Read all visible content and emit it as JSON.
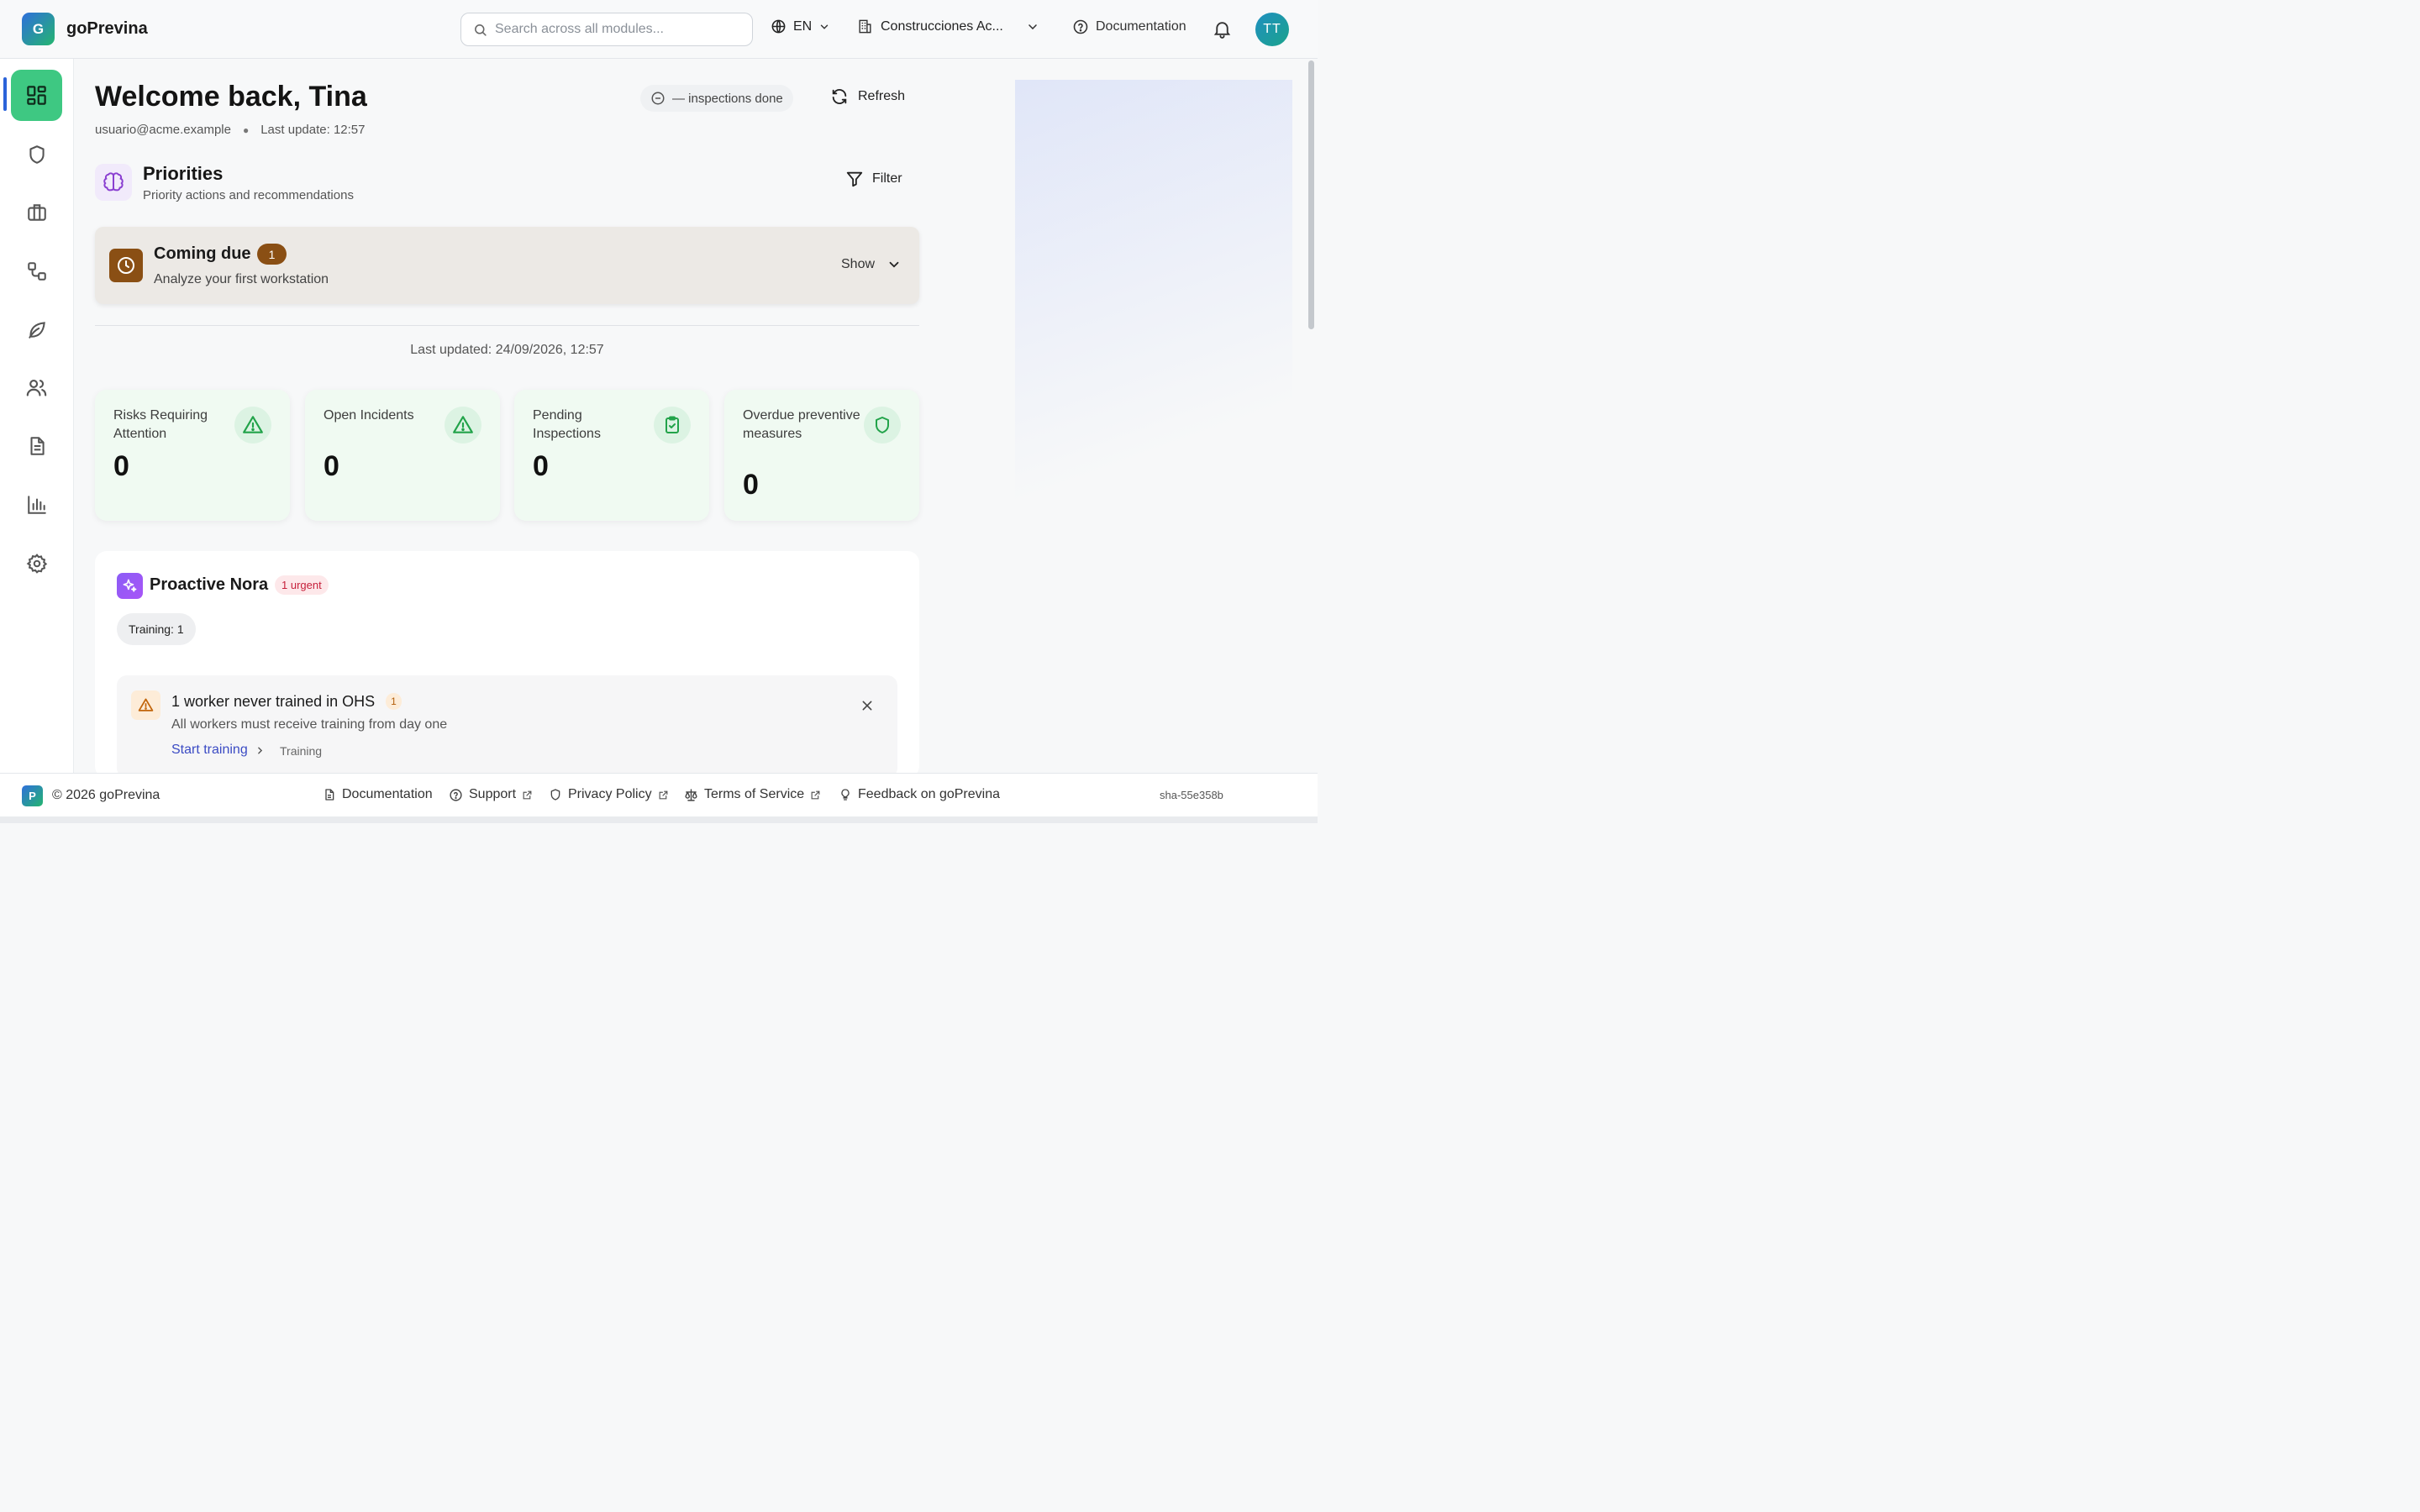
{
  "app": {
    "name": "goPrevina",
    "logo_letter": "G"
  },
  "header": {
    "search_placeholder": "Search across all modules...",
    "language": "EN",
    "company": "Construcciones Ac...",
    "docs_label": "Documentation",
    "avatar_initials": "TT"
  },
  "sidebar": {
    "items": [
      {
        "icon": "dashboard-icon",
        "active": true
      },
      {
        "icon": "shield-icon"
      },
      {
        "icon": "briefcase-icon"
      },
      {
        "icon": "workflow-icon"
      },
      {
        "icon": "leaf-icon"
      },
      {
        "icon": "users-icon"
      },
      {
        "icon": "document-icon"
      },
      {
        "icon": "bar-chart-icon"
      },
      {
        "icon": "gear-icon"
      }
    ]
  },
  "dashboard": {
    "welcome": "Welcome back, Tina",
    "email": "usuario@acme.example",
    "last_update": "Last update: 12:57",
    "inspections_pill": "— inspections done",
    "refresh_label": "Refresh"
  },
  "priorities": {
    "title": "Priorities",
    "subtitle": "Priority actions and recommendations",
    "filter_label": "Filter",
    "coming_due": {
      "title": "Coming due",
      "count": "1",
      "description": "Analyze your first workstation",
      "toggle_label": "Show"
    },
    "last_updated": "Last updated: 24/09/2026, 12:57"
  },
  "stats": [
    {
      "label": "Risks Requiring Attention",
      "value": "0",
      "icon": "warning-triangle-icon"
    },
    {
      "label": "Open Incidents",
      "value": "0",
      "icon": "warning-triangle-icon"
    },
    {
      "label": "Pending Inspections",
      "value": "0",
      "icon": "clipboard-check-icon"
    },
    {
      "label": "Overdue preventive measures",
      "value": "0",
      "icon": "shield-icon"
    }
  ],
  "nora": {
    "title": "Proactive Nora",
    "urgent_badge": "1 urgent",
    "filter_pill": "Training: 1",
    "alert": {
      "title": "1 worker never trained in OHS",
      "count": "1",
      "description": "All workers must receive training from day one",
      "action_label": "Start training",
      "tag": "Training"
    }
  },
  "footer": {
    "logo_letter": "P",
    "copyright": "© 2026 goPrevina",
    "links": [
      "Documentation",
      "Support",
      "Privacy Policy",
      "Terms of Service",
      "Feedback on goPrevina"
    ],
    "build": "sha-55e358b"
  },
  "colors": {
    "active_nav": "#3ec882",
    "accent_blue": "#2b63d9",
    "coming_due_brown": "#8a4f14",
    "stat_card_bg": "#f0faf2",
    "stat_icon_green": "#22a34a",
    "urgent_red": "#c6203b"
  }
}
